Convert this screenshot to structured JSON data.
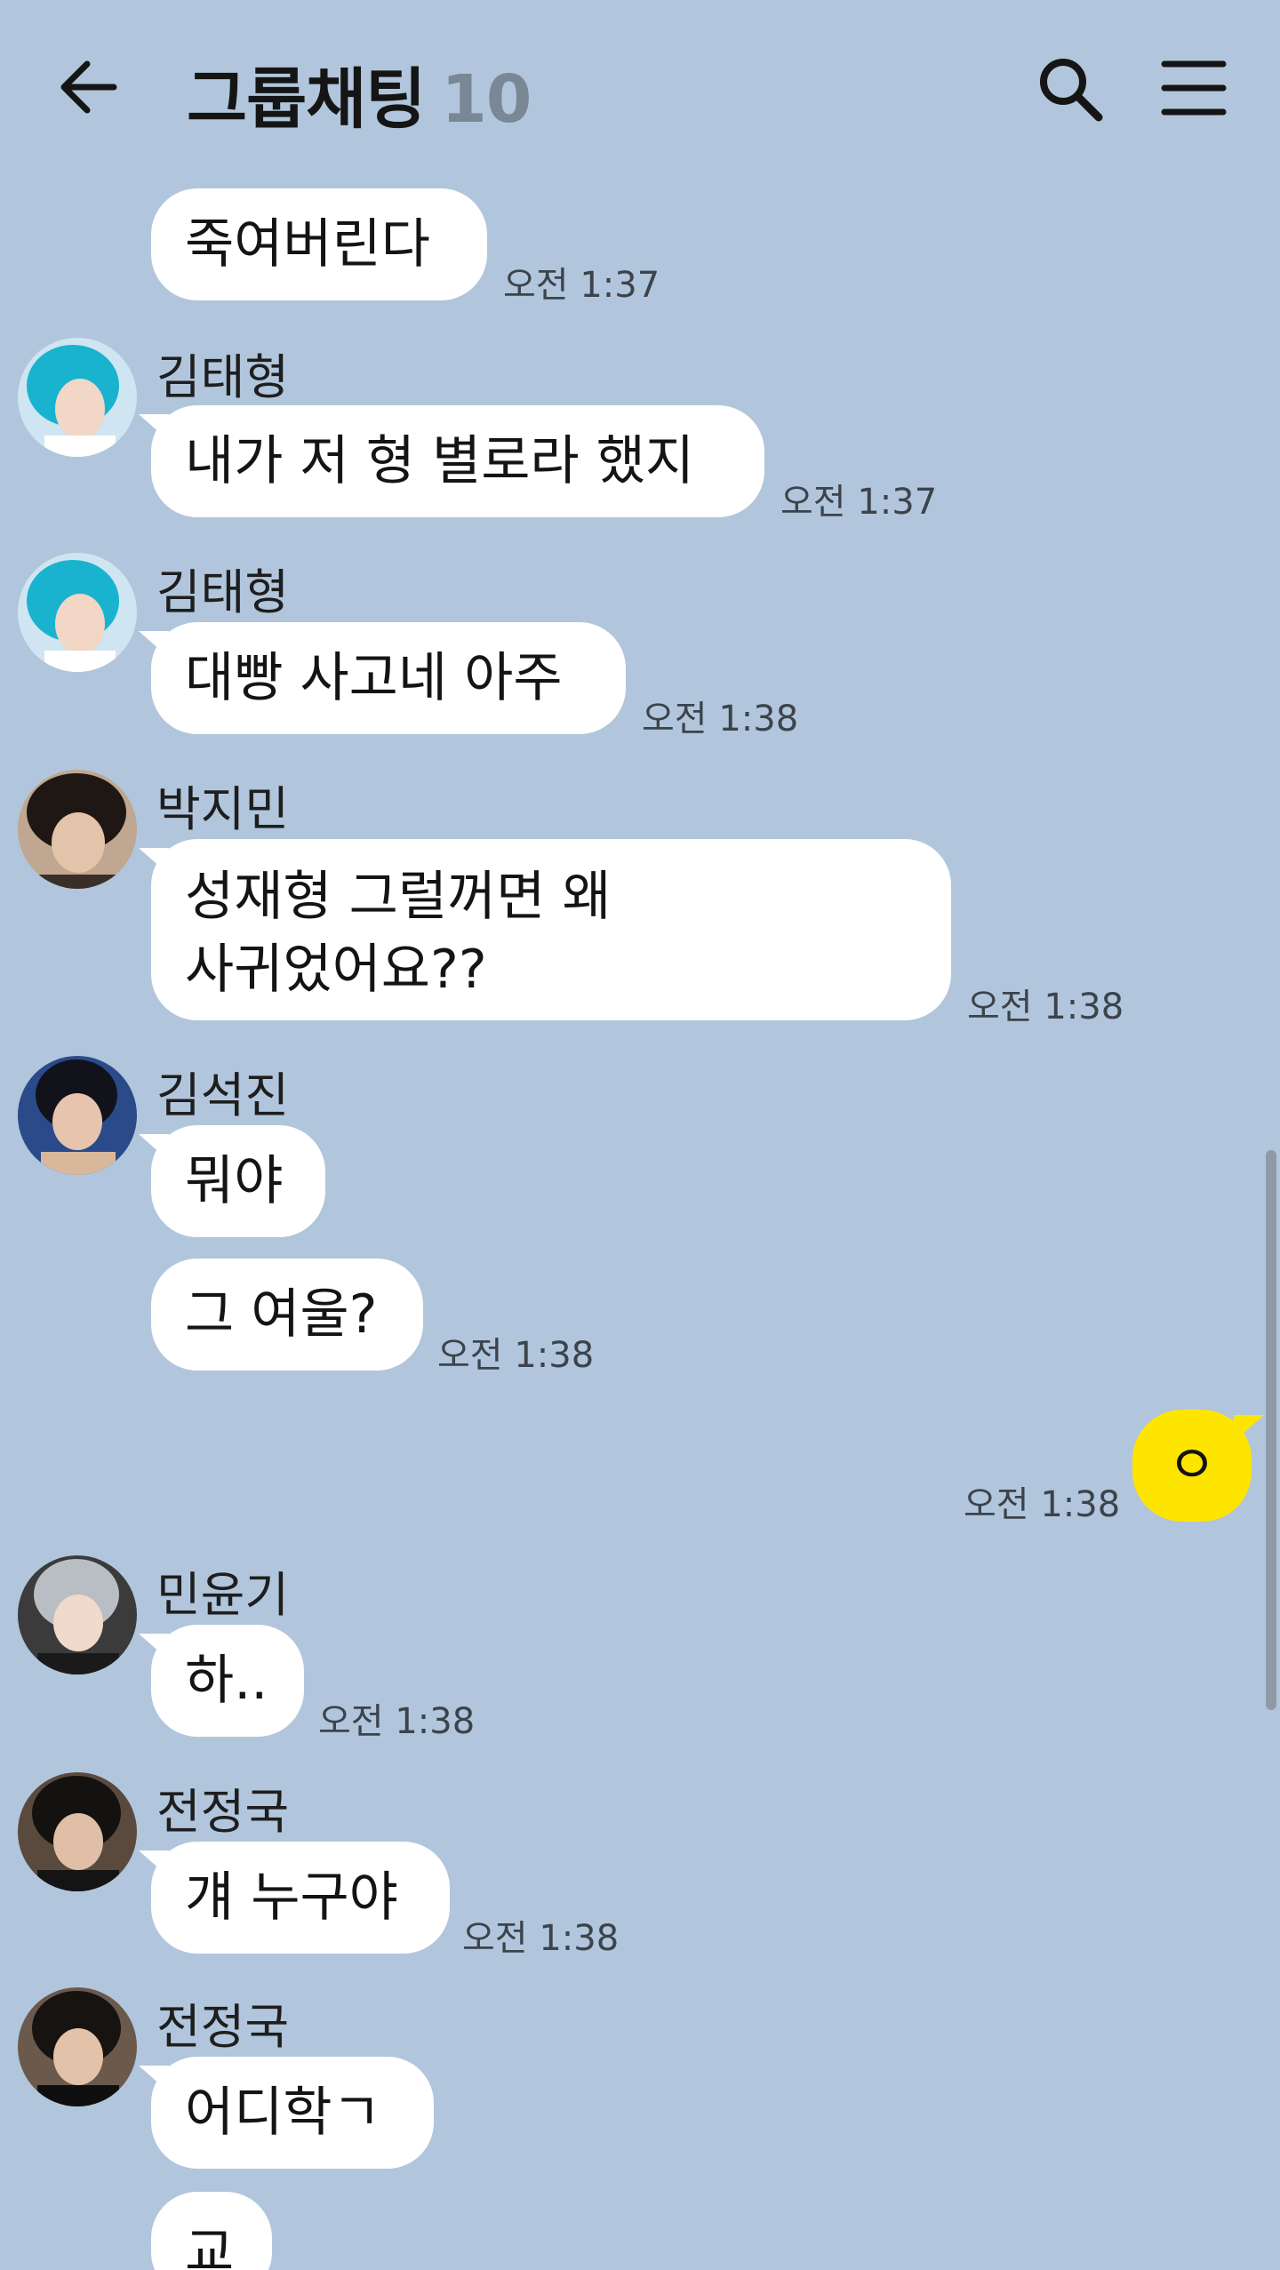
{
  "header": {
    "title": "그룹채팅",
    "member_count": "10",
    "back_icon": "back-arrow-icon",
    "search_icon": "search-icon",
    "menu_icon": "hamburger-menu-icon"
  },
  "messages": [
    {
      "text": "죽여버린다",
      "time": "오전 1:37"
    },
    {
      "sender": "김태형",
      "text": "내가 저 형 별로라 했지",
      "time": "오전 1:37"
    },
    {
      "sender": "김태형",
      "text": "대빵 사고네 아주",
      "time": "오전 1:38"
    },
    {
      "sender": "박지민",
      "text_line1": "성재형 그럴꺼면 왜",
      "text_line2": "사귀었어요??",
      "time": "오전 1:38"
    },
    {
      "sender": "김석진",
      "text": "뭐야"
    },
    {
      "text": "그 여울?",
      "time": "오전 1:38"
    },
    {
      "mine": true,
      "text": "ㅇ",
      "time": "오전 1:38"
    },
    {
      "sender": "민윤기",
      "text": "하..",
      "time": "오전 1:38"
    },
    {
      "sender": "전정국",
      "text": "걔 누구야",
      "time": "오전 1:38"
    },
    {
      "sender": "전정국",
      "text": "어디학ㄱ"
    },
    {
      "text": "교"
    }
  ],
  "colors": {
    "background": "#b1c6dc",
    "bubble_other": "#ffffff",
    "bubble_mine": "#fee500",
    "count": "#7a8795"
  }
}
